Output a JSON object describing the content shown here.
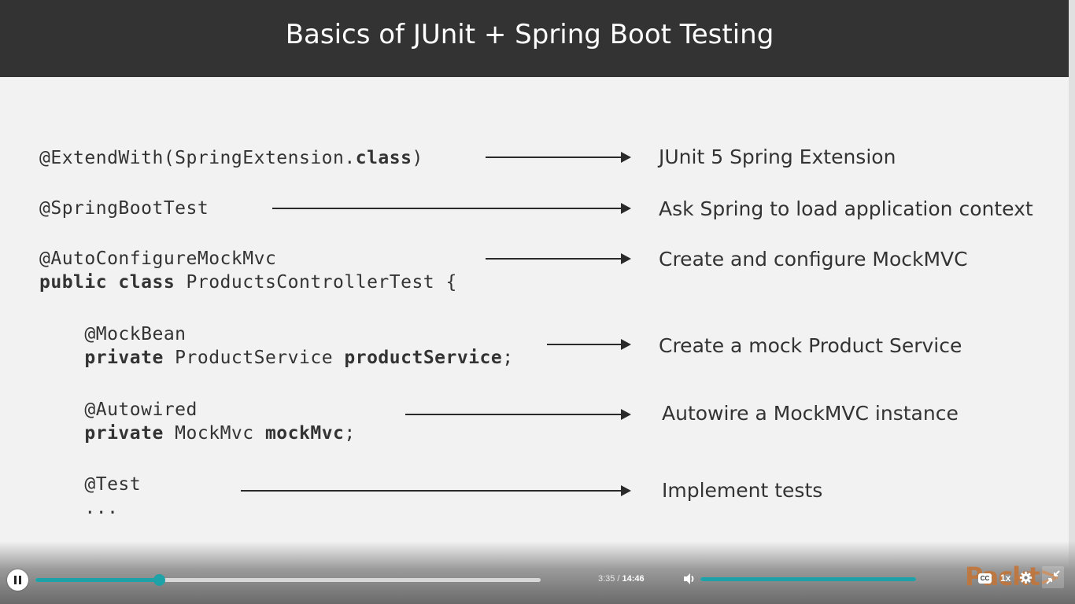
{
  "slide": {
    "title": "Basics of JUnit + Spring Boot Testing",
    "rows": [
      {
        "code": [
          [
            {
              "t": "@ExtendWith(SpringExtension."
            },
            {
              "t": "class",
              "b": true
            },
            {
              "t": ")"
            }
          ]
        ],
        "description": "JUnit 5 Spring Extension"
      },
      {
        "code": [
          [
            {
              "t": "@SpringBootTest"
            }
          ]
        ],
        "description": "Ask Spring to load application context"
      },
      {
        "code": [
          [
            {
              "t": "@AutoConfigureMockMvc"
            }
          ],
          [
            {
              "t": "public class",
              "b": true
            },
            {
              "t": " ProductsControllerTest {"
            }
          ]
        ],
        "description": "Create and configure MockMVC"
      },
      {
        "code": [
          [
            {
              "t": "    @MockBean"
            }
          ],
          [
            {
              "t": "    "
            },
            {
              "t": "private",
              "b": true
            },
            {
              "t": " ProductService "
            },
            {
              "t": "productService",
              "b": true
            },
            {
              "t": ";"
            }
          ]
        ],
        "description": "Create a mock Product Service"
      },
      {
        "code": [
          [
            {
              "t": "    @Autowired"
            }
          ],
          [
            {
              "t": "    "
            },
            {
              "t": "private",
              "b": true
            },
            {
              "t": " MockMvc "
            },
            {
              "t": "mockMvc",
              "b": true
            },
            {
              "t": ";"
            }
          ]
        ],
        "description": "Autowire a MockMVC instance"
      },
      {
        "code": [
          [
            {
              "t": "    @Test"
            }
          ],
          [
            {
              "t": "    ..."
            }
          ]
        ],
        "description": "Implement tests"
      }
    ]
  },
  "player": {
    "current_time": "3:35",
    "separator": "/",
    "duration": "14:46",
    "progress_fraction": 0.245,
    "volume_fraction": 1.0,
    "speed_label": "1x",
    "cc_label": "CC",
    "logo_text": "Packt>",
    "accent_color": "#1fa1a8",
    "icons": [
      "pause-icon",
      "volume-icon",
      "cc-icon",
      "gear-icon",
      "exit-fullscreen-icon"
    ]
  }
}
